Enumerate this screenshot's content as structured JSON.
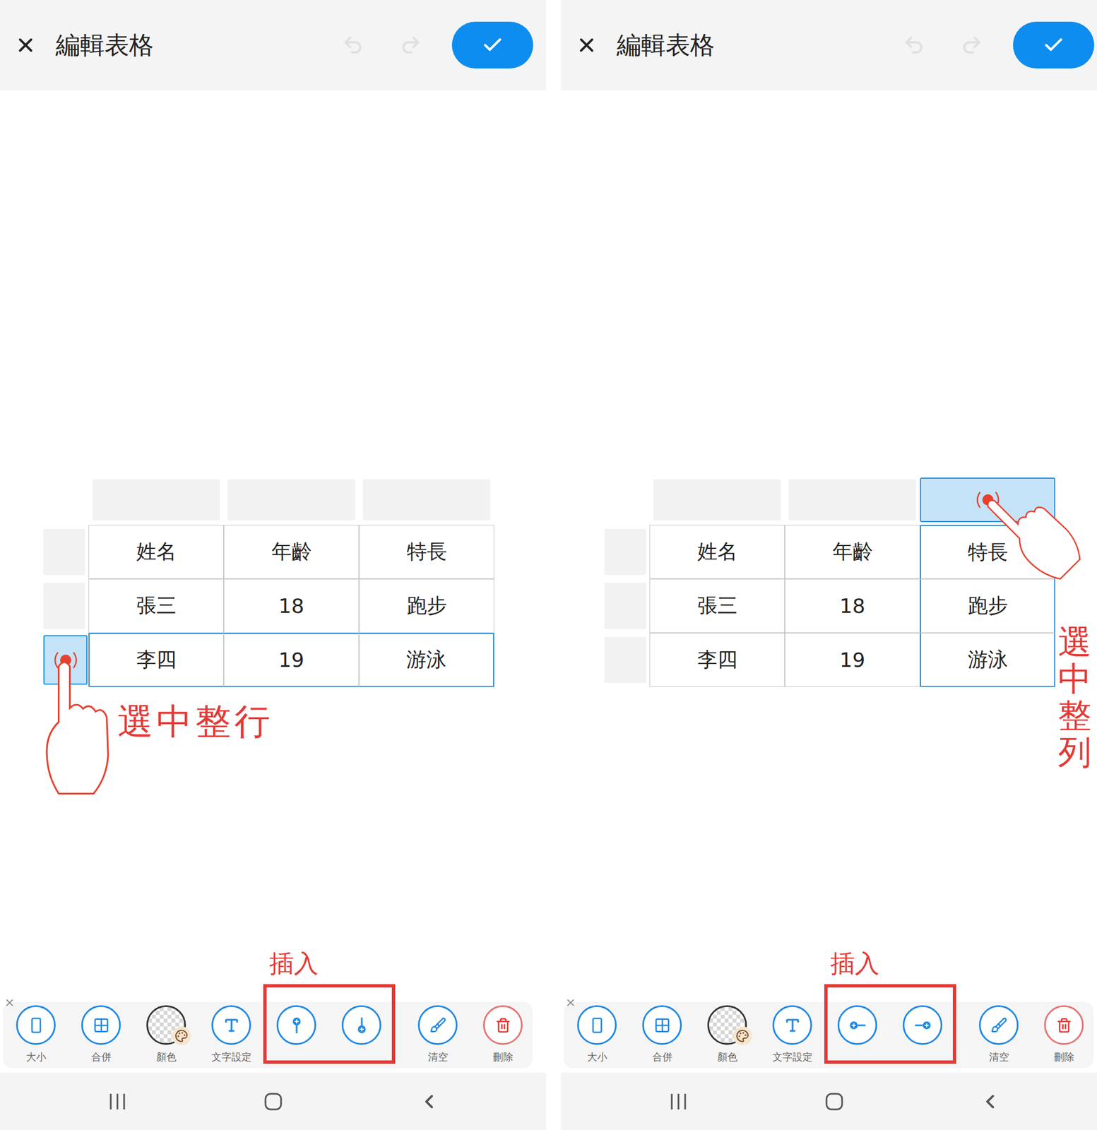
{
  "panels": [
    {
      "title": "編輯表格",
      "table": {
        "columns": [
          {
            "selected": false
          },
          {
            "selected": false
          },
          {
            "selected": false
          }
        ],
        "rows": [
          {
            "cells": [
              "姓名",
              "年齡",
              "特長"
            ],
            "selected": false
          },
          {
            "cells": [
              "張三",
              "18",
              "跑步"
            ],
            "selected": false
          },
          {
            "cells": [
              "李四",
              "19",
              "游泳"
            ],
            "selected": true
          }
        ]
      },
      "annotation": {
        "text": "選中整行",
        "vertical": false
      },
      "toolbar": {
        "close": "×",
        "before": [
          {
            "label": "大小",
            "kind": "size"
          },
          {
            "label": "合併",
            "kind": "merge"
          },
          {
            "label": "顏色",
            "kind": "color"
          },
          {
            "label": "文字設定",
            "kind": "text"
          }
        ],
        "insert": {
          "label": "插入",
          "buttons": [
            {
              "kind": "insert-above"
            },
            {
              "kind": "insert-below"
            }
          ]
        },
        "after": [
          {
            "label": "清空",
            "kind": "clear"
          },
          {
            "label": "刪除",
            "kind": "delete"
          }
        ]
      }
    },
    {
      "title": "編輯表格",
      "table": {
        "columns": [
          {
            "selected": false
          },
          {
            "selected": false
          },
          {
            "selected": true
          }
        ],
        "rows": [
          {
            "cells": [
              "姓名",
              "年齡",
              "特長"
            ],
            "selected": false
          },
          {
            "cells": [
              "張三",
              "18",
              "跑步"
            ],
            "selected": false
          },
          {
            "cells": [
              "李四",
              "19",
              "游泳"
            ],
            "selected": false
          }
        ]
      },
      "annotation": {
        "text": "選中整列",
        "vertical": true
      },
      "toolbar": {
        "close": "×",
        "before": [
          {
            "label": "大小",
            "kind": "size"
          },
          {
            "label": "合併",
            "kind": "merge"
          },
          {
            "label": "顏色",
            "kind": "color"
          },
          {
            "label": "文字設定",
            "kind": "text"
          }
        ],
        "insert": {
          "label": "插入",
          "buttons": [
            {
              "kind": "insert-left"
            },
            {
              "kind": "insert-right"
            }
          ]
        },
        "after": [
          {
            "label": "清空",
            "kind": "clear"
          },
          {
            "label": "刪除",
            "kind": "delete"
          }
        ]
      }
    }
  ]
}
